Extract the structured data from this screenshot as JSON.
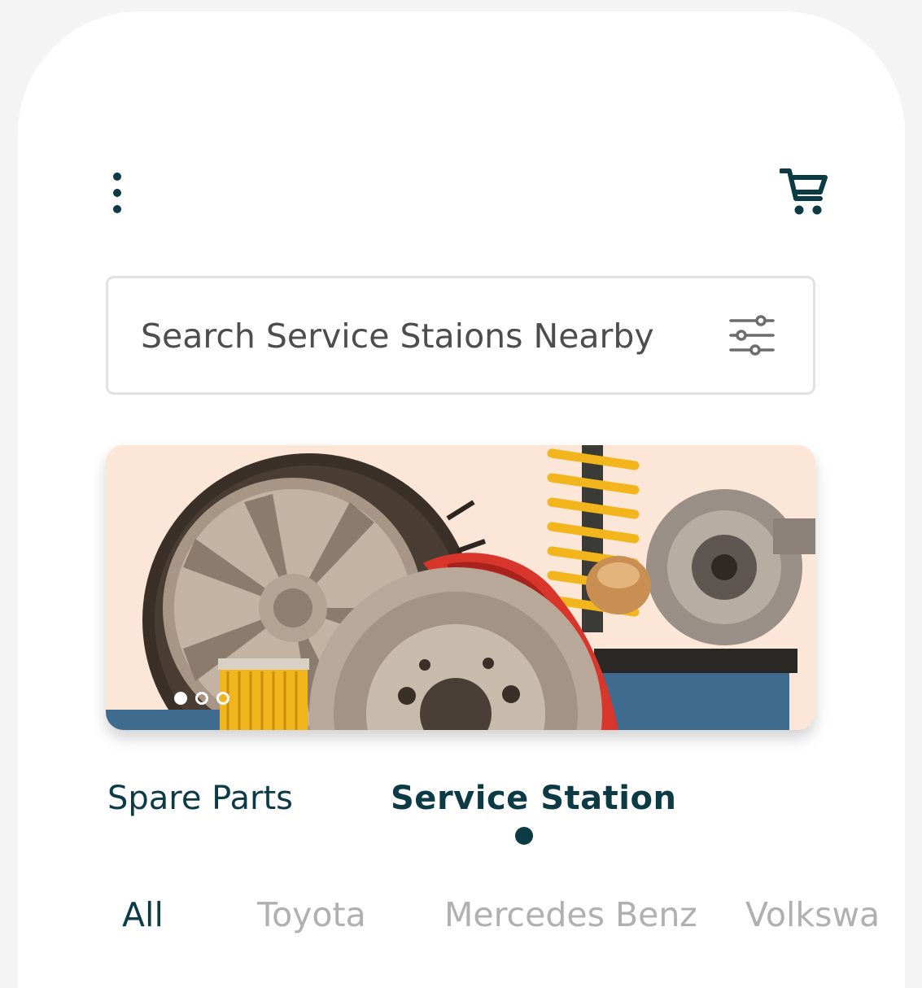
{
  "header": {
    "menu_icon": "more-vertical-icon",
    "cart_icon": "shopping-cart-icon"
  },
  "search": {
    "placeholder": "Search Service Staions Nearby",
    "filter_icon": "sliders-icon"
  },
  "banner": {
    "slides": 3,
    "active_slide": 0,
    "pager_icon": "dot-indicator-icon"
  },
  "tabs": {
    "items": [
      {
        "label": "Spare Parts",
        "active": false
      },
      {
        "label": "Service Station",
        "active": true
      }
    ]
  },
  "brands": {
    "items": [
      {
        "label": "All",
        "active": true
      },
      {
        "label": "Toyota",
        "active": false
      },
      {
        "label": "Mercedes Benz",
        "active": false
      },
      {
        "label": "Volkswagen",
        "active": false
      }
    ]
  },
  "colors": {
    "primary": "#0d3b45",
    "muted": "#b0b0b0",
    "banner_bg": "#fbe6d8",
    "caliper": "#d9362b",
    "spring": "#f2b51c"
  }
}
